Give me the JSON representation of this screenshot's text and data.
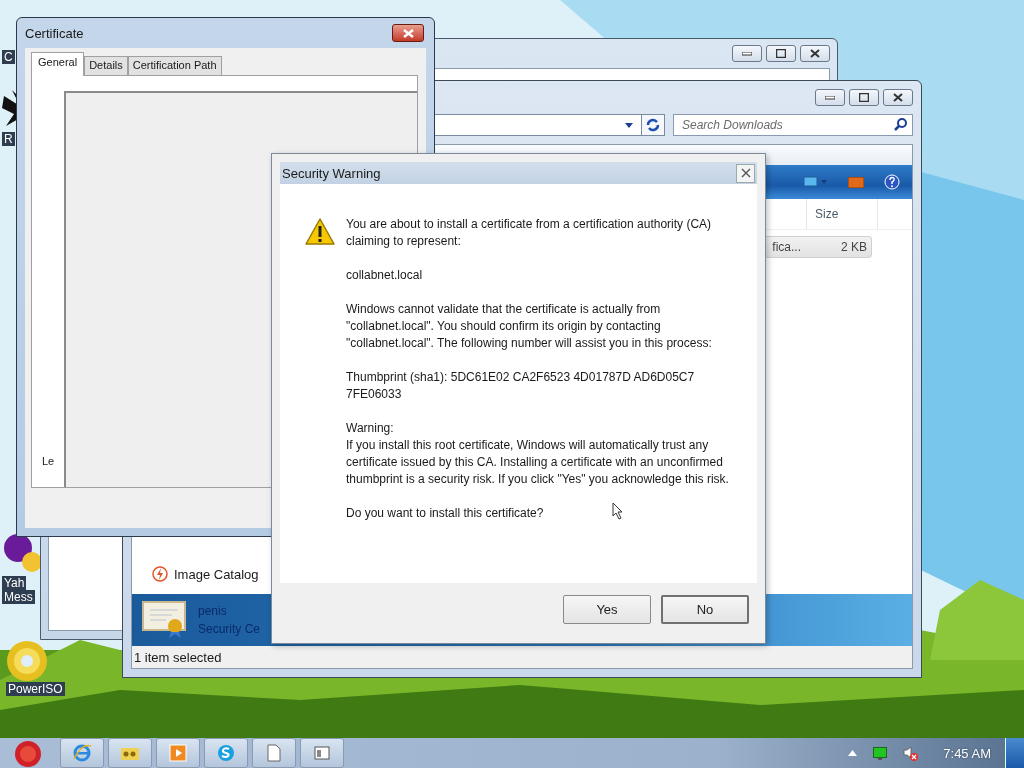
{
  "desktop_icons": [
    {
      "kind": "blank",
      "label": [
        "C"
      ]
    },
    {
      "kind": "splat",
      "label": [
        "R"
      ]
    },
    {
      "kind": "messenger",
      "label": [
        "Yah",
        "Mess"
      ]
    },
    {
      "kind": "disc",
      "label": [
        "PowerISO"
      ]
    }
  ],
  "certificate_window": {
    "title": "Certificate",
    "tabs": [
      {
        "label": "General",
        "selected": true
      },
      {
        "label": "Details",
        "selected": false
      },
      {
        "label": "Certification Path",
        "selected": false
      }
    ],
    "cut_text": "Le"
  },
  "explorer_window": {
    "search": {
      "placeholder": "Search Downloads"
    },
    "columns": [
      "Size"
    ],
    "rows": [
      {
        "name": "fica...",
        "size": "2 KB",
        "selected": true
      }
    ],
    "nav_items": [
      "Image Catalog"
    ],
    "details": {
      "name": "penis",
      "type": "Security Ce"
    },
    "status_bar": "1 item selected"
  },
  "dialog": {
    "title": "Security Warning",
    "paragraphs": [
      {
        "kind": "text",
        "text": "You are about to install a certificate from a certification authority (CA) claiming to represent:"
      },
      {
        "kind": "text",
        "text": "collabnet.local"
      },
      {
        "kind": "text",
        "text": "Windows cannot validate that the certificate is actually from \"collabnet.local\". You should confirm its origin by contacting \"collabnet.local\". The following number will assist you in this process:"
      },
      {
        "kind": "text",
        "text": "Thumbprint (sha1): 5DC61E02 CA2F6523 4D01787D AD6D05C7 7FE06033"
      },
      {
        "kind": "heading",
        "text": "Warning:"
      },
      {
        "kind": "text",
        "text": "If you install this root certificate, Windows will automatically trust any certificate issued by this CA. Installing a certificate with an unconfirmed thumbprint is a security risk. If you click \"Yes\" you acknowledge this risk."
      },
      {
        "kind": "text",
        "text": "Do you want to install this certificate?"
      }
    ],
    "buttons": [
      {
        "label": "Yes",
        "default": false
      },
      {
        "label": "No",
        "default": true
      }
    ]
  },
  "taskbar": {
    "time": "7:45 AM"
  }
}
